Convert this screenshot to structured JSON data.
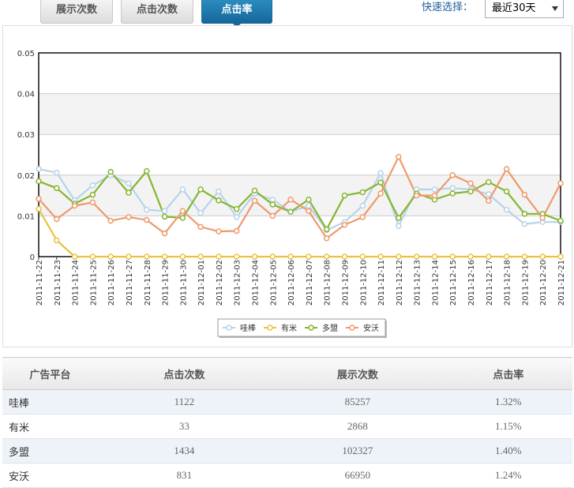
{
  "tabs": [
    {
      "label": "展示次数",
      "active": false
    },
    {
      "label": "点击次数",
      "active": false
    },
    {
      "label": "点击率",
      "active": true
    }
  ],
  "quick_select": {
    "label": "快速选择：",
    "value": "最近30天"
  },
  "chart_data": {
    "type": "line",
    "ylim": [
      0,
      0.05
    ],
    "yticks": [
      "0",
      "0.01",
      "0.02",
      "0.03",
      "0.04",
      "0.05"
    ],
    "grid": "horizontal, alternating bands",
    "legend_position": "bottom-center",
    "categories": [
      "2011-11-22",
      "2011-11-23",
      "2011-11-24",
      "2011-11-25",
      "2011-11-26",
      "2011-11-27",
      "2011-11-28",
      "2011-11-29",
      "2011-11-30",
      "2011-12-01",
      "2011-12-02",
      "2011-12-03",
      "2011-12-04",
      "2011-12-05",
      "2011-12-06",
      "2011-12-07",
      "2011-12-08",
      "2011-12-09",
      "2011-12-10",
      "2011-12-11",
      "2011-12-12",
      "2011-12-13",
      "2011-12-14",
      "2011-12-15",
      "2011-12-16",
      "2011-12-17",
      "2011-12-18",
      "2011-12-19",
      "2011-12-20",
      "2011-12-21"
    ],
    "series": [
      {
        "name": "哇棒",
        "color": "#b7d3ea",
        "values": [
          0.0215,
          0.0206,
          0.0138,
          0.0175,
          0.02,
          0.018,
          0.0115,
          0.0112,
          0.0165,
          0.0107,
          0.016,
          0.0097,
          0.0155,
          0.014,
          0.011,
          0.0125,
          0.0065,
          0.0085,
          0.0125,
          0.0205,
          0.0075,
          0.0165,
          0.0165,
          0.0168,
          0.0165,
          0.0153,
          0.0115,
          0.008,
          0.0085,
          0.0085
        ]
      },
      {
        "name": "有米",
        "color": "#e8c241",
        "values": [
          0.0117,
          0.004,
          0,
          0,
          0,
          0,
          0,
          0,
          0,
          0,
          0,
          0,
          0,
          0,
          0,
          0,
          0,
          0,
          0,
          0,
          0,
          0,
          0,
          0,
          0,
          0,
          0,
          0,
          0,
          0
        ]
      },
      {
        "name": "多盟",
        "color": "#86b52f",
        "values": [
          0.0185,
          0.0168,
          0.013,
          0.0152,
          0.0208,
          0.0157,
          0.021,
          0.0098,
          0.0095,
          0.0165,
          0.0138,
          0.0117,
          0.0162,
          0.0128,
          0.011,
          0.014,
          0.0067,
          0.015,
          0.0158,
          0.0182,
          0.0095,
          0.0155,
          0.014,
          0.0155,
          0.016,
          0.0183,
          0.016,
          0.0105,
          0.0105,
          0.0088
        ]
      },
      {
        "name": "安沃",
        "color": "#ef9a6c",
        "values": [
          0.0142,
          0.0092,
          0.0125,
          0.0133,
          0.0088,
          0.0097,
          0.009,
          0.0057,
          0.0112,
          0.0073,
          0.0062,
          0.0063,
          0.0137,
          0.01,
          0.014,
          0.0112,
          0.0045,
          0.0078,
          0.0097,
          0.0155,
          0.0245,
          0.015,
          0.015,
          0.02,
          0.018,
          0.0137,
          0.0215,
          0.0152,
          0.0095,
          0.018
        ]
      }
    ]
  },
  "table": {
    "headers": [
      "广告平台",
      "点击次数",
      "展示次数",
      "点击率"
    ],
    "rows": [
      [
        "哇棒",
        "1122",
        "85257",
        "1.32%"
      ],
      [
        "有米",
        "33",
        "2868",
        "1.15%"
      ],
      [
        "多盟",
        "1434",
        "102327",
        "1.40%"
      ],
      [
        "安沃",
        "831",
        "66950",
        "1.24%"
      ]
    ]
  }
}
